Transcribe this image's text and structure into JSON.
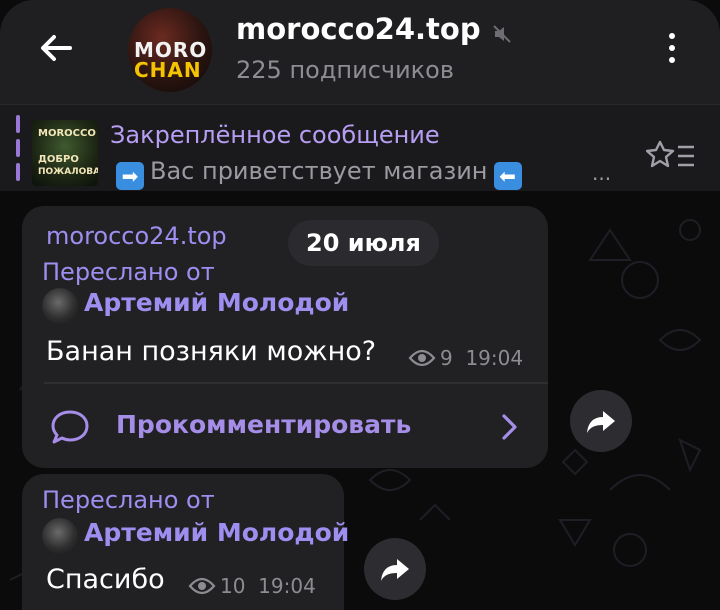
{
  "header": {
    "title": "morocco24.top",
    "subscribers": "225 подписчиков",
    "avatar_text_top": "MORO",
    "avatar_text_bottom": "CHAN"
  },
  "pinned": {
    "title": "Закреплённое сообщение",
    "text": "Вас приветствует магазин",
    "ellipsis": "...",
    "thumb_line1": "MOROCCO",
    "thumb_line2": "ДОБРО",
    "thumb_line3": "ПОЖАЛОВАТЬ"
  },
  "messages": [
    {
      "channel_name": "morocco24.top",
      "date": "20 июля",
      "forwarded_label": "Переслано от",
      "author": "Артемий Молодой",
      "text": "Банан позняки можно?",
      "views": "9",
      "time": "19:04",
      "comment_label": "Прокомментировать"
    },
    {
      "forwarded_label": "Переслано от",
      "author": "Артемий Молодой",
      "text": "Спасибо",
      "views": "10",
      "time": "19:04"
    }
  ],
  "colors": {
    "accent": "#9d8ef0",
    "bubble": "#212124",
    "header": "#1f1f22",
    "background": "#0b0b0c"
  },
  "icons": [
    "back-arrow-icon",
    "mute-icon",
    "more-vert-icon",
    "unpin-list-icon",
    "eye-icon",
    "comment-icon",
    "chevron-right-icon",
    "share-icon",
    "arrow-right-emoji",
    "arrow-left-emoji"
  ]
}
